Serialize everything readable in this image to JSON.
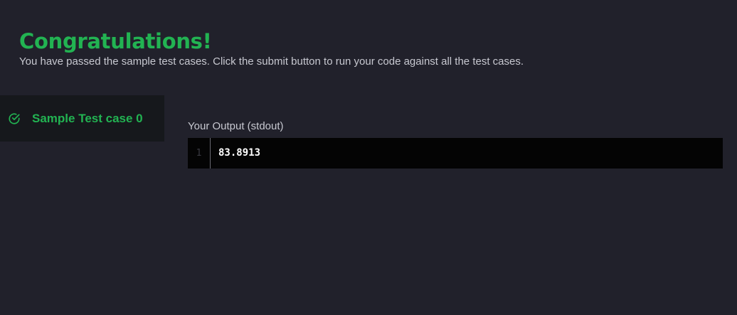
{
  "result": {
    "title": "Congratulations!",
    "message": "You have passed the sample test cases. Click the submit button to run your code against all the test cases."
  },
  "testcases": [
    {
      "label": "Sample Test case 0",
      "status": "passed",
      "icon": "check-circle-icon"
    }
  ],
  "output": {
    "label": "Your Output (stdout)",
    "lines": [
      {
        "number": "1",
        "text": "83.8913"
      }
    ]
  },
  "colors": {
    "background": "#21212b",
    "success": "#22b352",
    "sidebar_item_bg": "#16181c",
    "output_bg": "#040404"
  }
}
